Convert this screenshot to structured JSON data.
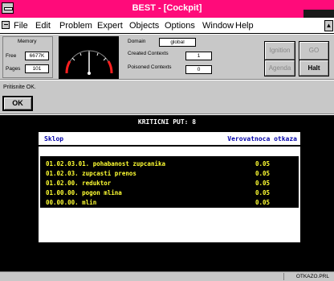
{
  "window": {
    "title": "BEST - [Cockpit]"
  },
  "menu": [
    "File",
    "Edit",
    "Problem",
    "Expert",
    "Objects",
    "Options",
    "Window",
    "Help"
  ],
  "memory": {
    "group_label": "Memory",
    "free_label": "Free",
    "free_value": "6677K",
    "pages_label": "Pages",
    "pages_value": "101"
  },
  "gauge": {
    "level": 0.5
  },
  "status_fields": {
    "domain_label": "Domain",
    "domain_value": "global",
    "created_label": "Created Contexts",
    "created_value": "1",
    "poisoned_label": "Poisoned Contexts",
    "poisoned_value": "0"
  },
  "buttons": {
    "ignition": "Ignition",
    "go": "GO",
    "agenda": "Agenda",
    "halt": "Halt"
  },
  "message": {
    "text": "Pritisnite OK.",
    "ok": "OK"
  },
  "result": {
    "heading": "KRITICNI PUT: 8",
    "col_part": "Sklop",
    "col_prob": "Verovatnoca otkaza",
    "rows": [
      {
        "part": "01.02.03.01. pohabanost zupcanika",
        "prob": "0.05"
      },
      {
        "part": "01.02.03. zupcasti prenos",
        "prob": "0.05"
      },
      {
        "part": "01.02.00. reduktor",
        "prob": "0.05"
      },
      {
        "part": "01.00.00. pogon mlina",
        "prob": "0.05"
      },
      {
        "part": "00.00.00. mlin",
        "prob": "0.05"
      }
    ]
  },
  "statusbar": {
    "file": "OTKAZO.PRL"
  },
  "colors": {
    "titlebar": "#ff0b7a",
    "content_bg": "#000000",
    "row_text": "#ffff33",
    "header_text": "#0000a8"
  }
}
